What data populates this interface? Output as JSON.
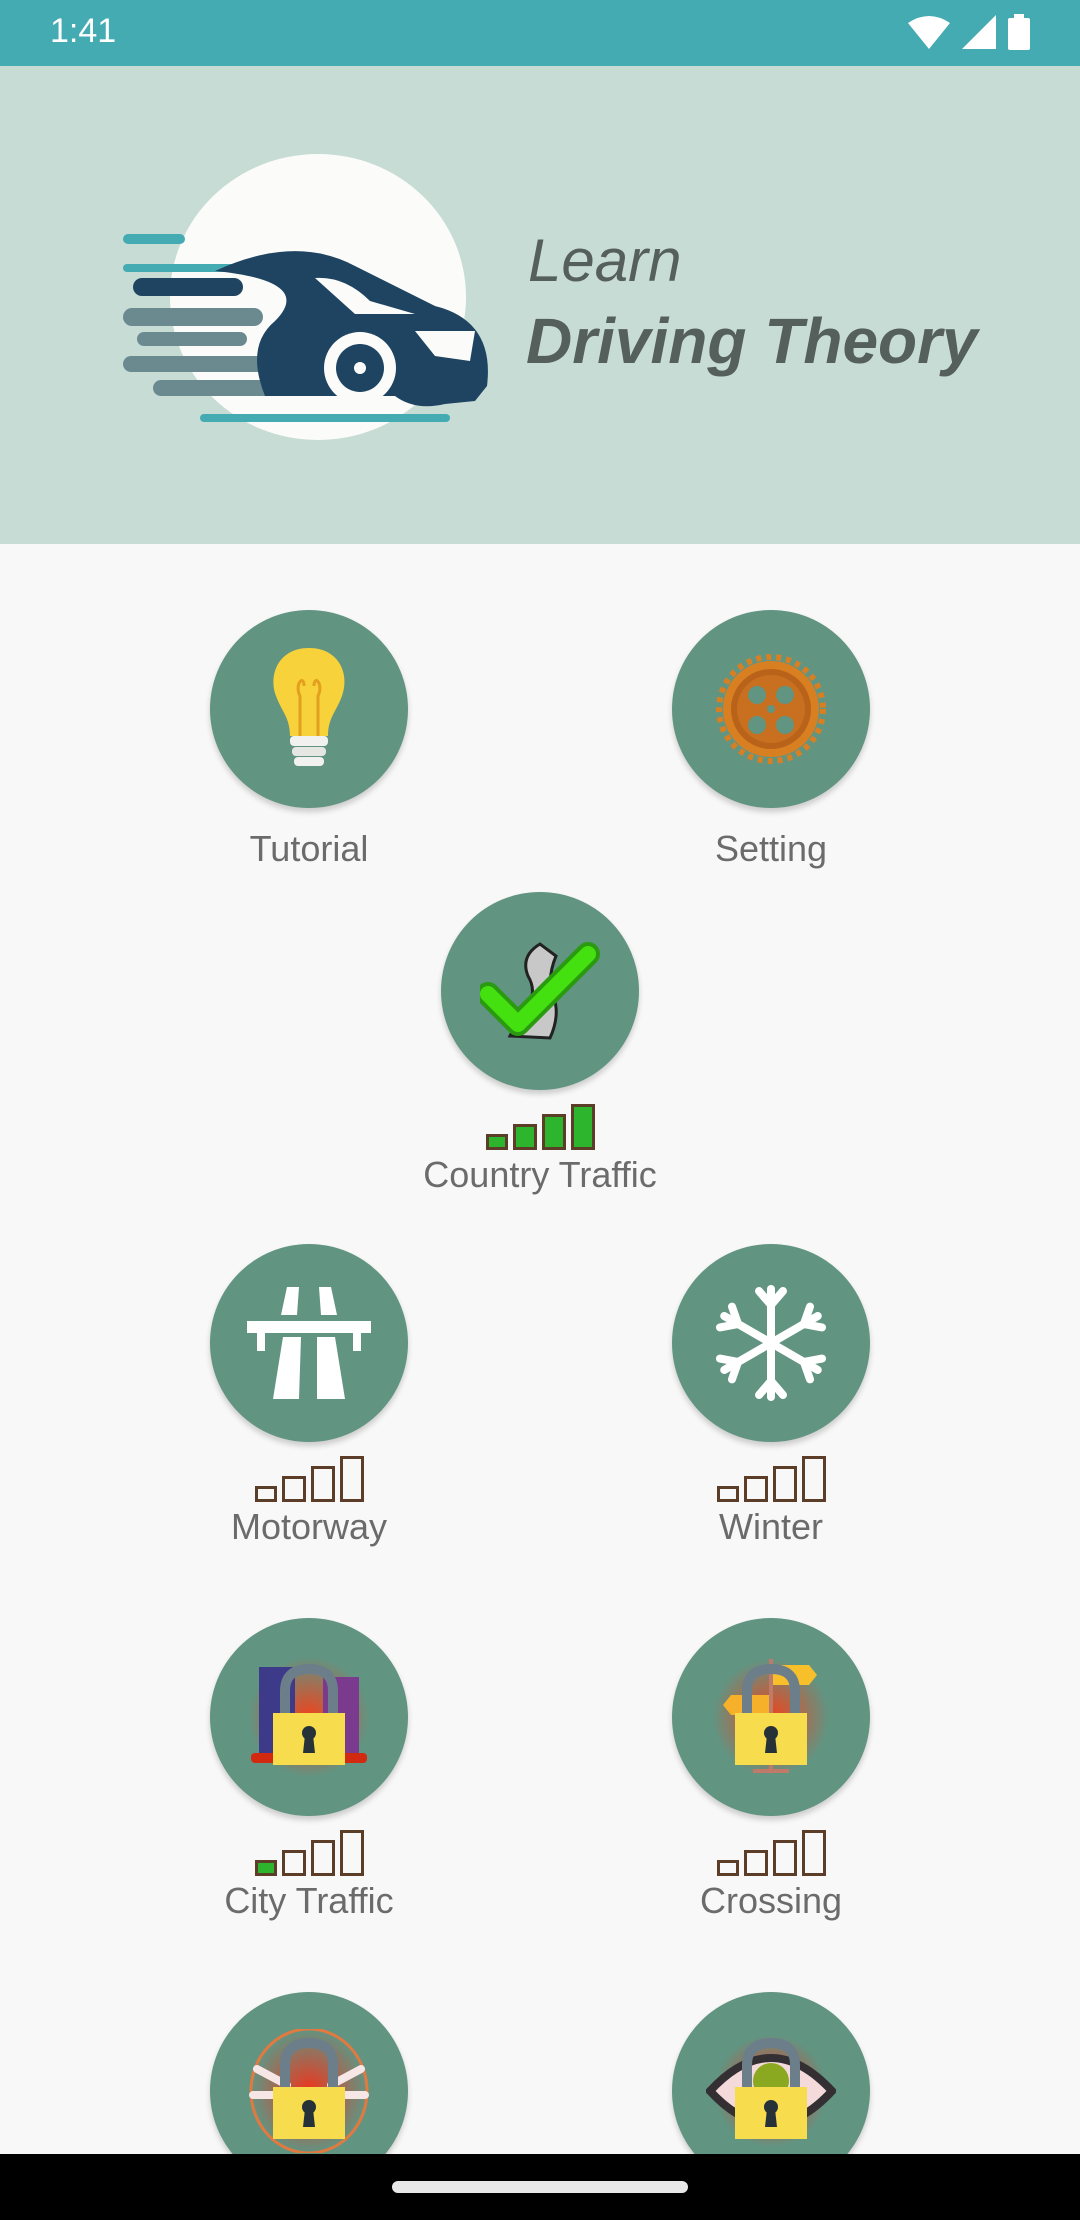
{
  "status_bar": {
    "time": "1:41",
    "icons": [
      "wifi-icon",
      "cellular-signal-icon",
      "battery-icon"
    ],
    "color": "#44abb3"
  },
  "header": {
    "title_line1": "Learn",
    "title_line2": "Driving Theory",
    "logo_icon": "speeding-car-logo",
    "background": "#c8dcd6"
  },
  "menu": {
    "circle_color": "#629482",
    "progress_filled_color": "#2db52d",
    "progress_border_color": "#5c3e28",
    "items": [
      {
        "label": "Tutorial",
        "icon": "lightbulb-icon",
        "locked": false,
        "progress_levels": null
      },
      {
        "label": "Setting",
        "icon": "gear-icon",
        "locked": false,
        "progress_levels": null
      },
      {
        "label": "Country Traffic",
        "icon": "winding-road-checkmark-icon",
        "locked": false,
        "completed": true,
        "progress_levels": 4,
        "progress_max": 4
      },
      {
        "label": "Motorway",
        "icon": "motorway-icon",
        "locked": false,
        "progress_levels": 0,
        "progress_max": 4
      },
      {
        "label": "Winter",
        "icon": "snowflake-icon",
        "locked": false,
        "progress_levels": 0,
        "progress_max": 4
      },
      {
        "label": "City Traffic",
        "icon": "city-padlock-icon",
        "locked": true,
        "progress_levels": 1,
        "progress_max": 4
      },
      {
        "label": "Crossing",
        "icon": "signpost-padlock-icon",
        "locked": true,
        "progress_levels": 0,
        "progress_max": 4
      },
      {
        "label": "",
        "icon": "pedestrian-padlock-icon",
        "locked": true
      },
      {
        "label": "",
        "icon": "eye-padlock-icon",
        "locked": true
      }
    ]
  }
}
